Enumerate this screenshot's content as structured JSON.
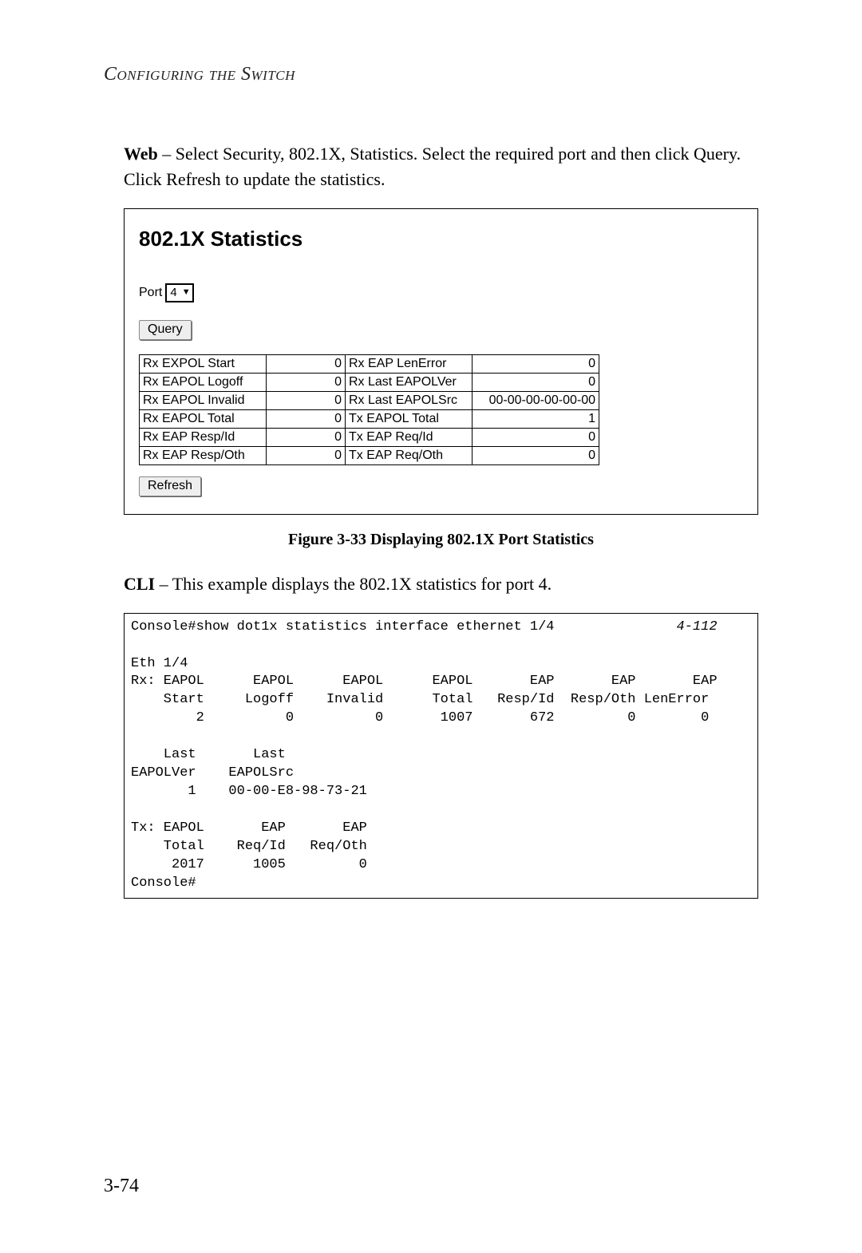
{
  "header": {
    "running_head": "Configuring the Switch"
  },
  "intro": {
    "web_lead": "Web",
    "web_text": " – Select Security, 802.1X, Statistics. Select the required port and then click Query. Click Refresh to update the statistics."
  },
  "web_panel": {
    "title": "802.1X Statistics",
    "port_label": "Port",
    "port_value": "4",
    "query_btn": "Query",
    "refresh_btn": "Refresh",
    "rows": [
      {
        "l_label": "Rx EXPOL Start",
        "l_val": "0",
        "r_label": "Rx EAP LenError",
        "r_val": "0"
      },
      {
        "l_label": "Rx EAPOL Logoff",
        "l_val": "0",
        "r_label": "Rx Last EAPOLVer",
        "r_val": "0"
      },
      {
        "l_label": "Rx EAPOL Invalid",
        "l_val": "0",
        "r_label": "Rx Last EAPOLSrc",
        "r_val": "00-00-00-00-00-00"
      },
      {
        "l_label": "Rx EAPOL Total",
        "l_val": "0",
        "r_label": "Tx EAPOL Total",
        "r_val": "1"
      },
      {
        "l_label": "Rx EAP Resp/Id",
        "l_val": "0",
        "r_label": "Tx EAP Req/Id",
        "r_val": "0"
      },
      {
        "l_label": "Rx EAP Resp/Oth",
        "l_val": "0",
        "r_label": "Tx EAP Req/Oth",
        "r_val": "0"
      }
    ]
  },
  "figure_caption": "Figure 3-33  Displaying 802.1X Port Statistics",
  "cli": {
    "lead": "CLI",
    "text": " – This example displays the 802.1X statistics for port 4.",
    "ref": "4-112",
    "lines": {
      "l1": "Console#show dot1x statistics interface ethernet 1/4",
      "l2": "",
      "l3": "Eth 1/4",
      "l4": "Rx: EAPOL      EAPOL      EAPOL      EAPOL       EAP       EAP       EAP",
      "l5": "    Start     Logoff    Invalid      Total   Resp/Id  Resp/Oth LenError",
      "l6": "        2          0          0       1007       672         0        0",
      "l7": "",
      "l8": "    Last       Last",
      "l9": "EAPOLVer    EAPOLSrc",
      "l10": "       1    00-00-E8-98-73-21",
      "l11": "",
      "l12": "Tx: EAPOL       EAP       EAP",
      "l13": "    Total    Req/Id   Req/Oth",
      "l14": "     2017      1005         0",
      "l15": "Console#"
    }
  },
  "page_number": "3-74"
}
